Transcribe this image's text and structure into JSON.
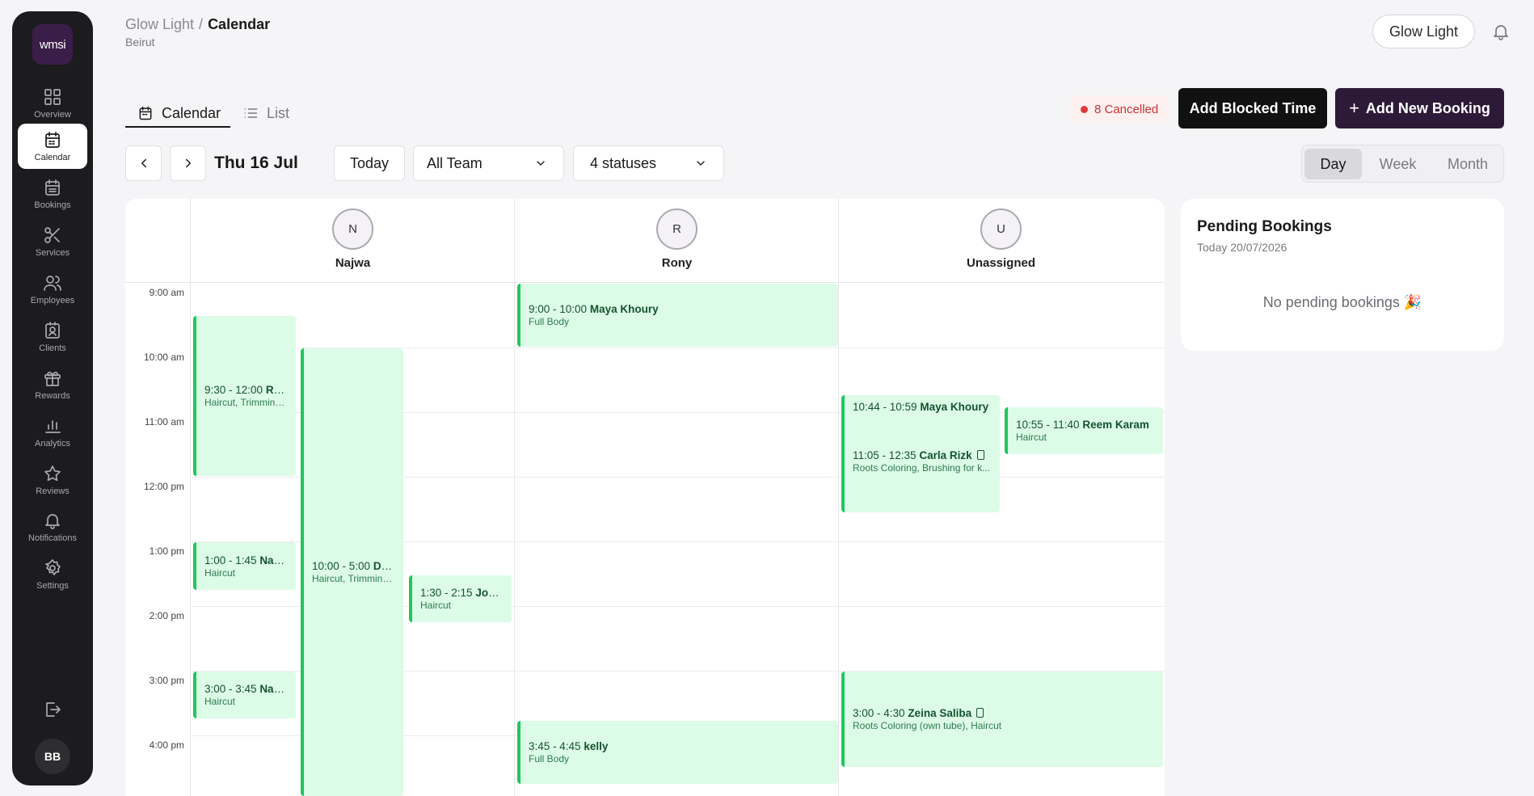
{
  "sidebar": {
    "logo": "wmsi",
    "items": [
      {
        "label": "Overview",
        "icon": "grid-icon"
      },
      {
        "label": "Calendar",
        "icon": "calendar-icon",
        "active": true
      },
      {
        "label": "Bookings",
        "icon": "calendar-grid-icon"
      },
      {
        "label": "Services",
        "icon": "scissors-icon"
      },
      {
        "label": "Employees",
        "icon": "users-icon"
      },
      {
        "label": "Clients",
        "icon": "id-card-icon"
      },
      {
        "label": "Rewards",
        "icon": "gift-icon"
      },
      {
        "label": "Analytics",
        "icon": "bar-chart-icon"
      },
      {
        "label": "Reviews",
        "icon": "star-icon"
      },
      {
        "label": "Notifications",
        "icon": "bell-icon"
      },
      {
        "label": "Settings",
        "icon": "gear-icon"
      }
    ],
    "avatar_initials": "BB"
  },
  "header": {
    "breadcrumb_parent": "Glow Light",
    "breadcrumb_separator": "/",
    "breadcrumb_current": "Calendar",
    "location": "Beirut",
    "business_pill": "Glow Light"
  },
  "tabs": [
    {
      "label": "Calendar",
      "active": true
    },
    {
      "label": "List",
      "active": false
    }
  ],
  "actions": {
    "cancelled": "8 Cancelled",
    "add_blocked": "Add Blocked Time",
    "add_booking": "Add New Booking",
    "add_booking_plus": "+"
  },
  "controls": {
    "date": "Thu 16 Jul",
    "today": "Today",
    "team_filter": "All Team",
    "status_filter": "4 statuses",
    "views": [
      "Day",
      "Week",
      "Month"
    ],
    "active_view": "Day"
  },
  "calendar": {
    "hours": [
      "9:00 am",
      "10:00 am",
      "11:00 am",
      "12:00 pm",
      "1:00 pm",
      "2:00 pm",
      "3:00 pm",
      "4:00 pm"
    ],
    "staff": [
      {
        "initial": "N",
        "name": "Najwa"
      },
      {
        "initial": "R",
        "name": "Rony"
      },
      {
        "initial": "U",
        "name": "Unassigned"
      }
    ],
    "events": [
      {
        "time": "9:30 - 12:00",
        "client": "Ran...",
        "service": "Haircut, Trimming...",
        "staff": "Najwa"
      },
      {
        "time": "10:00 - 5:00",
        "client": "Da...",
        "service": "Haircut, Trimming...",
        "staff": "Najwa"
      },
      {
        "time": "1:00 - 1:45",
        "client": "Nadi...",
        "service": "Haircut",
        "staff": "Najwa"
      },
      {
        "time": "1:30 - 2:15",
        "client": "Joell...",
        "service": "Haircut",
        "staff": "Najwa"
      },
      {
        "time": "3:00 - 3:45",
        "client": "Nadi...",
        "service": "Haircut",
        "staff": "Najwa"
      },
      {
        "time": "9:00 - 10:00",
        "client": "Maya Khoury",
        "service": "Full Body",
        "staff": "Rony"
      },
      {
        "time": "3:45 - 4:45",
        "client": "kelly",
        "service": "Full Body",
        "staff": "Rony"
      },
      {
        "time": "10:44 - 10:59",
        "client": "Maya Khoury",
        "service": "",
        "staff": "Unassigned"
      },
      {
        "time": "11:05 - 12:35",
        "client": "Carla Rizk",
        "service": "Roots Coloring, Brushing for k...",
        "staff": "Unassigned",
        "mobile": true
      },
      {
        "time": "10:55 - 11:40",
        "client": "Reem Karam",
        "service": "Haircut",
        "staff": "Unassigned"
      },
      {
        "time": "3:00 - 4:30",
        "client": "Zeina Saliba",
        "service": "Roots Coloring (own tube), Haircut",
        "staff": "Unassigned",
        "mobile": true
      }
    ]
  },
  "pending": {
    "title": "Pending Bookings",
    "date": "Today 20/07/2026",
    "empty": "No pending bookings 🎉"
  },
  "colors": {
    "sidebar_bg": "#1c1c1e",
    "accent": "#2d1a38",
    "event_bg": "#dcfce7",
    "event_border": "#22c55e",
    "cancel_red": "#e0393b"
  }
}
